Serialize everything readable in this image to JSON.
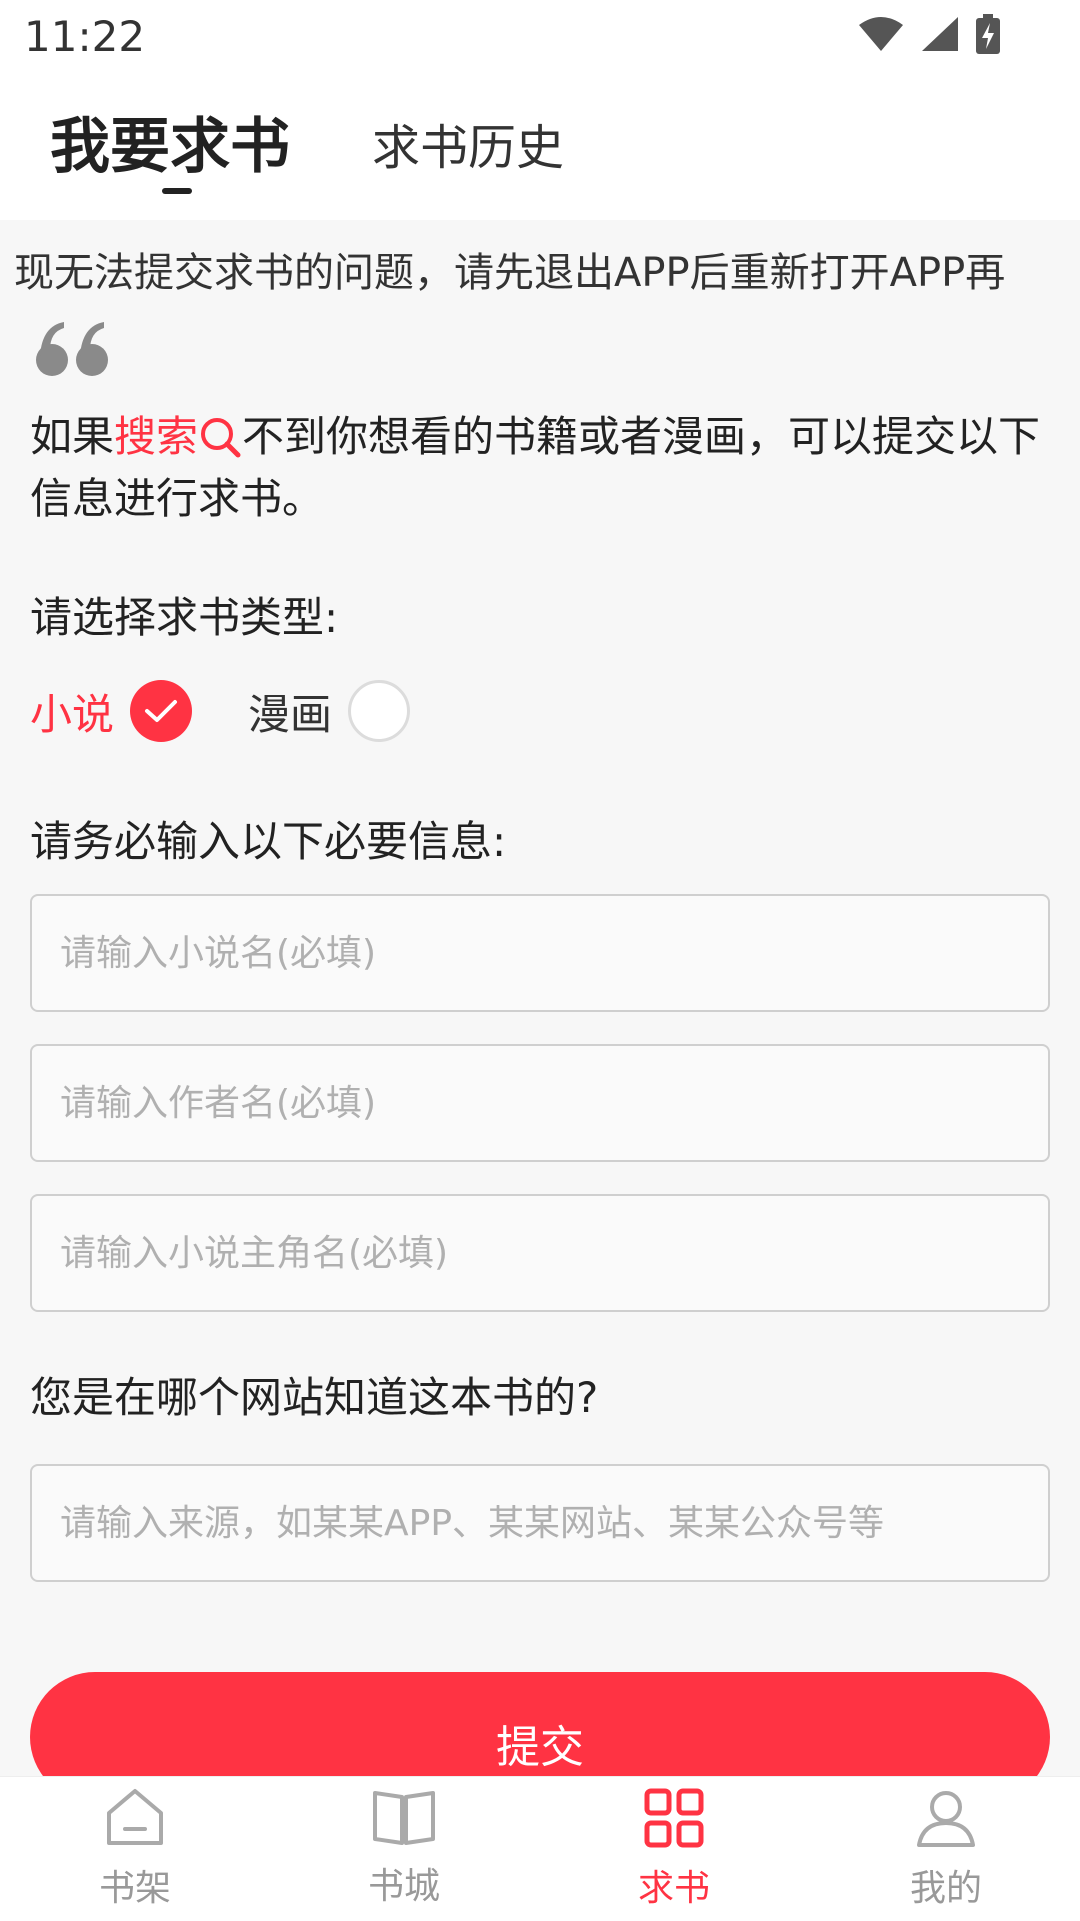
{
  "status_bar": {
    "time": "11:22"
  },
  "tabs": {
    "active": "我要求书",
    "history": "求书历史"
  },
  "notice": "现无法提交求书的问题，请先退出APP后重新打开APP再",
  "intro": {
    "prefix": "如果",
    "search": "搜索",
    "suffix": "不到你想看的书籍或者漫画，可以提交以下信息进行求书。"
  },
  "type_section": {
    "label": "请选择求书类型:",
    "options": [
      {
        "label": "小说",
        "selected": true
      },
      {
        "label": "漫画",
        "selected": false
      }
    ]
  },
  "required_section": {
    "label": "请务必输入以下必要信息:",
    "fields": [
      {
        "placeholder": "请输入小说名(必填)"
      },
      {
        "placeholder": "请输入作者名(必填)"
      },
      {
        "placeholder": "请输入小说主角名(必填)"
      }
    ]
  },
  "source_section": {
    "label": "您是在哪个网站知道这本书的?",
    "placeholder": "请输入来源，如某某APP、某某网站、某某公众号等"
  },
  "submit_label": "提交",
  "bottom_nav": [
    {
      "label": "书架",
      "icon": "bookshelf-icon",
      "active": false
    },
    {
      "label": "书城",
      "icon": "book-icon",
      "active": false
    },
    {
      "label": "求书",
      "icon": "grid-icon",
      "active": true
    },
    {
      "label": "我的",
      "icon": "user-icon",
      "active": false
    }
  ],
  "colors": {
    "accent": "#ff3343",
    "text": "#222222",
    "muted": "#999999"
  }
}
